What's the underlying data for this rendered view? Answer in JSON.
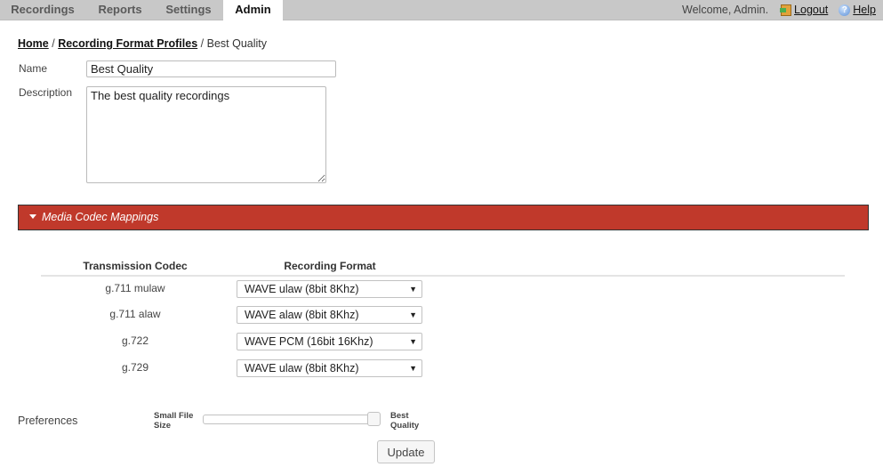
{
  "nav": {
    "tabs": [
      {
        "label": "Recordings",
        "active": false
      },
      {
        "label": "Reports",
        "active": false
      },
      {
        "label": "Settings",
        "active": false
      },
      {
        "label": "Admin",
        "active": true
      }
    ],
    "welcome": "Welcome, Admin.",
    "logout_label": "Logout",
    "logout_icon": "logout-door-icon",
    "help_label": "Help",
    "help_icon": "help-question-icon",
    "help_glyph": "?"
  },
  "breadcrumb": {
    "items": [
      "Home",
      "Recording Format Profiles"
    ],
    "separator": "/",
    "current": "Best Quality"
  },
  "form": {
    "name_label": "Name",
    "name_value": "Best Quality",
    "description_label": "Description",
    "description_value": "The best quality recordings"
  },
  "section": {
    "title": "Media Codec Mappings",
    "expanded": true,
    "accent_color": "#c0392b"
  },
  "mappings": {
    "headers": {
      "codec": "Transmission Codec",
      "format": "Recording Format"
    },
    "rows": [
      {
        "codec": "g.711 mulaw",
        "format": "WAVE ulaw (8bit 8Khz)"
      },
      {
        "codec": "g.711 alaw",
        "format": "WAVE alaw (8bit 8Khz)"
      },
      {
        "codec": "g.722",
        "format": "WAVE PCM (16bit 16Khz)"
      },
      {
        "codec": "g.729",
        "format": "WAVE ulaw (8bit 8Khz)"
      }
    ],
    "dropdown_arrow": "▼"
  },
  "preferences": {
    "label": "Preferences",
    "min_label": "Small File Size",
    "max_label": "Best Quality",
    "slider_value_percent": 100
  },
  "update_label": "Update"
}
